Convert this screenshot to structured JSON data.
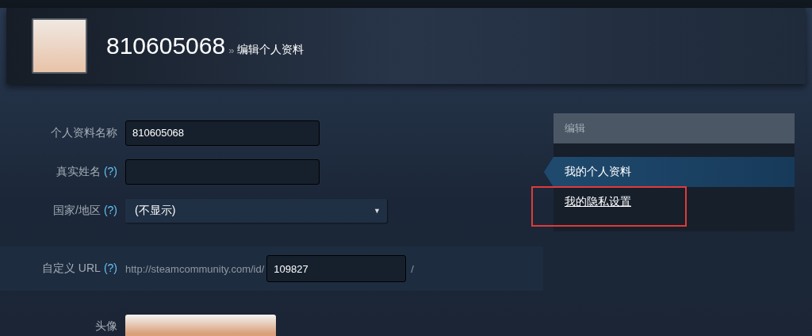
{
  "header": {
    "name": "810605068",
    "separator": "»",
    "subtitle": "编辑个人资料"
  },
  "form": {
    "fields": [
      {
        "kind": "text",
        "label": "个人资料名称",
        "value": "810605068"
      },
      {
        "kind": "text",
        "label": "真实姓名",
        "help": "(?)"
      },
      {
        "kind": "select",
        "label": "国家/地区",
        "help": "(?)",
        "value": "(不显示)",
        "arrow": "▼"
      },
      {
        "kind": "url",
        "label": "自定义 URL",
        "help": "(?)",
        "prefix": "http://steamcommunity.com/id/",
        "value": "109827",
        "suffix": "/"
      },
      {
        "kind": "image",
        "label": "头像"
      }
    ]
  },
  "sidebar": {
    "title": "编辑",
    "items": [
      {
        "label": "我的个人资料",
        "selected": true,
        "highlighted": false
      },
      {
        "label": "我的隐私设置",
        "selected": false,
        "highlighted": true
      }
    ]
  }
}
